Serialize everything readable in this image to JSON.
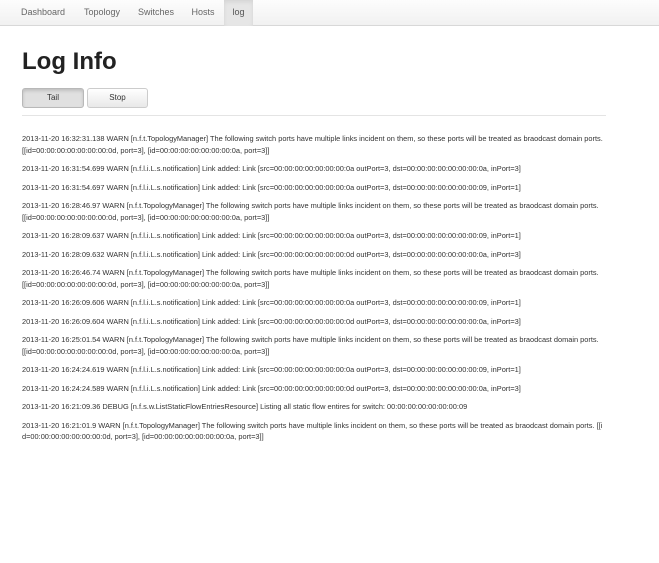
{
  "nav": {
    "items": [
      {
        "label": "Dashboard",
        "active": false
      },
      {
        "label": "Topology",
        "active": false
      },
      {
        "label": "Switches",
        "active": false
      },
      {
        "label": "Hosts",
        "active": false
      },
      {
        "label": "log",
        "active": true
      }
    ]
  },
  "page": {
    "title": "Log Info"
  },
  "controls": {
    "tail_label": "Tail",
    "stop_label": "Stop",
    "tail_active": true
  },
  "log": {
    "entries": [
      "2013-11-20 16:32:31.138 WARN [n.f.t.TopologyManager] The following switch ports have multiple links incident on them, so these ports will be treated as braodcast domain ports. [[id=00:00:00:00:00:00:00:0d, port=3], [id=00:00:00:00:00:00:00:0a, port=3]]",
      "2013-11-20 16:31:54.699 WARN [n.f.l.i.L.s.notification] Link added: Link [src=00:00:00:00:00:00:00:0a outPort=3, dst=00:00:00:00:00:00:00:0a, inPort=3]",
      "2013-11-20 16:31:54.697 WARN [n.f.l.i.L.s.notification] Link added: Link [src=00:00:00:00:00:00:00:0a outPort=3, dst=00:00:00:00:00:00:00:09, inPort=1]",
      "2013-11-20 16:28:46.97 WARN [n.f.t.TopologyManager] The following switch ports have multiple links incident on them, so these ports will be treated as braodcast domain ports. [[id=00:00:00:00:00:00:00:0d, port=3], [id=00:00:00:00:00:00:00:0a, port=3]]",
      "2013-11-20 16:28:09.637 WARN [n.f.l.i.L.s.notification] Link added: Link [src=00:00:00:00:00:00:00:0a outPort=3, dst=00:00:00:00:00:00:00:09, inPort=1]",
      "2013-11-20 16:28:09.632 WARN [n.f.l.i.L.s.notification] Link added: Link [src=00:00:00:00:00:00:00:0d outPort=3, dst=00:00:00:00:00:00:00:0a, inPort=3]",
      "2013-11-20 16:26:46.74 WARN [n.f.t.TopologyManager] The following switch ports have multiple links incident on them, so these ports will be treated as braodcast domain ports. [[id=00:00:00:00:00:00:00:0d, port=3], [id=00:00:00:00:00:00:00:0a, port=3]]",
      "2013-11-20 16:26:09.606 WARN [n.f.l.i.L.s.notification] Link added: Link [src=00:00:00:00:00:00:00:0a outPort=3, dst=00:00:00:00:00:00:00:09, inPort=1]",
      "2013-11-20 16:26:09.604 WARN [n.f.l.i.L.s.notification] Link added: Link [src=00:00:00:00:00:00:00:0d outPort=3, dst=00:00:00:00:00:00:00:0a, inPort=3]",
      "2013-11-20 16:25:01.54 WARN [n.f.t.TopologyManager] The following switch ports have multiple links incident on them, so these ports will be treated as braodcast domain ports. [[id=00:00:00:00:00:00:00:0d, port=3], [id=00:00:00:00:00:00:00:0a, port=3]]",
      "2013-11-20 16:24:24.619 WARN [n.f.l.i.L.s.notification] Link added: Link [src=00:00:00:00:00:00:00:0a outPort=3, dst=00:00:00:00:00:00:00:09, inPort=1]",
      "2013-11-20 16:24:24.589 WARN [n.f.l.i.L.s.notification] Link added: Link [src=00:00:00:00:00:00:00:0d outPort=3, dst=00:00:00:00:00:00:00:0a, inPort=3]",
      "2013-11-20 16:21:09.36 DEBUG [n.f.s.w.ListStaticFlowEntriesResource] Listing all static flow entires for switch: 00:00:00:00:00:00:00:09",
      "2013-11-20 16:21:01.9 WARN [n.f.t.TopologyManager] The following switch ports have multiple links incident on them, so these ports will be treated as braodcast domain ports. [[id=00:00:00:00:00:00:00:0d, port=3], [id=00:00:00:00:00:00:00:0a, port=3]]"
    ]
  }
}
